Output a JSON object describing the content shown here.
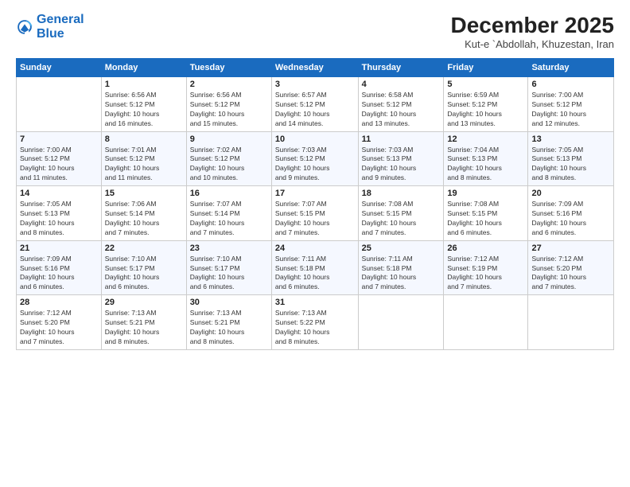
{
  "logo": {
    "line1": "General",
    "line2": "Blue"
  },
  "title": "December 2025",
  "subtitle": "Kut-e `Abdollah, Khuzestan, Iran",
  "days_header": [
    "Sunday",
    "Monday",
    "Tuesday",
    "Wednesday",
    "Thursday",
    "Friday",
    "Saturday"
  ],
  "weeks": [
    [
      {
        "day": "",
        "info": ""
      },
      {
        "day": "1",
        "info": "Sunrise: 6:56 AM\nSunset: 5:12 PM\nDaylight: 10 hours\nand 16 minutes."
      },
      {
        "day": "2",
        "info": "Sunrise: 6:56 AM\nSunset: 5:12 PM\nDaylight: 10 hours\nand 15 minutes."
      },
      {
        "day": "3",
        "info": "Sunrise: 6:57 AM\nSunset: 5:12 PM\nDaylight: 10 hours\nand 14 minutes."
      },
      {
        "day": "4",
        "info": "Sunrise: 6:58 AM\nSunset: 5:12 PM\nDaylight: 10 hours\nand 13 minutes."
      },
      {
        "day": "5",
        "info": "Sunrise: 6:59 AM\nSunset: 5:12 PM\nDaylight: 10 hours\nand 13 minutes."
      },
      {
        "day": "6",
        "info": "Sunrise: 7:00 AM\nSunset: 5:12 PM\nDaylight: 10 hours\nand 12 minutes."
      }
    ],
    [
      {
        "day": "7",
        "info": "Sunrise: 7:00 AM\nSunset: 5:12 PM\nDaylight: 10 hours\nand 11 minutes."
      },
      {
        "day": "8",
        "info": "Sunrise: 7:01 AM\nSunset: 5:12 PM\nDaylight: 10 hours\nand 11 minutes."
      },
      {
        "day": "9",
        "info": "Sunrise: 7:02 AM\nSunset: 5:12 PM\nDaylight: 10 hours\nand 10 minutes."
      },
      {
        "day": "10",
        "info": "Sunrise: 7:03 AM\nSunset: 5:12 PM\nDaylight: 10 hours\nand 9 minutes."
      },
      {
        "day": "11",
        "info": "Sunrise: 7:03 AM\nSunset: 5:13 PM\nDaylight: 10 hours\nand 9 minutes."
      },
      {
        "day": "12",
        "info": "Sunrise: 7:04 AM\nSunset: 5:13 PM\nDaylight: 10 hours\nand 8 minutes."
      },
      {
        "day": "13",
        "info": "Sunrise: 7:05 AM\nSunset: 5:13 PM\nDaylight: 10 hours\nand 8 minutes."
      }
    ],
    [
      {
        "day": "14",
        "info": "Sunrise: 7:05 AM\nSunset: 5:13 PM\nDaylight: 10 hours\nand 8 minutes."
      },
      {
        "day": "15",
        "info": "Sunrise: 7:06 AM\nSunset: 5:14 PM\nDaylight: 10 hours\nand 7 minutes."
      },
      {
        "day": "16",
        "info": "Sunrise: 7:07 AM\nSunset: 5:14 PM\nDaylight: 10 hours\nand 7 minutes."
      },
      {
        "day": "17",
        "info": "Sunrise: 7:07 AM\nSunset: 5:15 PM\nDaylight: 10 hours\nand 7 minutes."
      },
      {
        "day": "18",
        "info": "Sunrise: 7:08 AM\nSunset: 5:15 PM\nDaylight: 10 hours\nand 7 minutes."
      },
      {
        "day": "19",
        "info": "Sunrise: 7:08 AM\nSunset: 5:15 PM\nDaylight: 10 hours\nand 6 minutes."
      },
      {
        "day": "20",
        "info": "Sunrise: 7:09 AM\nSunset: 5:16 PM\nDaylight: 10 hours\nand 6 minutes."
      }
    ],
    [
      {
        "day": "21",
        "info": "Sunrise: 7:09 AM\nSunset: 5:16 PM\nDaylight: 10 hours\nand 6 minutes."
      },
      {
        "day": "22",
        "info": "Sunrise: 7:10 AM\nSunset: 5:17 PM\nDaylight: 10 hours\nand 6 minutes."
      },
      {
        "day": "23",
        "info": "Sunrise: 7:10 AM\nSunset: 5:17 PM\nDaylight: 10 hours\nand 6 minutes."
      },
      {
        "day": "24",
        "info": "Sunrise: 7:11 AM\nSunset: 5:18 PM\nDaylight: 10 hours\nand 6 minutes."
      },
      {
        "day": "25",
        "info": "Sunrise: 7:11 AM\nSunset: 5:18 PM\nDaylight: 10 hours\nand 7 minutes."
      },
      {
        "day": "26",
        "info": "Sunrise: 7:12 AM\nSunset: 5:19 PM\nDaylight: 10 hours\nand 7 minutes."
      },
      {
        "day": "27",
        "info": "Sunrise: 7:12 AM\nSunset: 5:20 PM\nDaylight: 10 hours\nand 7 minutes."
      }
    ],
    [
      {
        "day": "28",
        "info": "Sunrise: 7:12 AM\nSunset: 5:20 PM\nDaylight: 10 hours\nand 7 minutes."
      },
      {
        "day": "29",
        "info": "Sunrise: 7:13 AM\nSunset: 5:21 PM\nDaylight: 10 hours\nand 8 minutes."
      },
      {
        "day": "30",
        "info": "Sunrise: 7:13 AM\nSunset: 5:21 PM\nDaylight: 10 hours\nand 8 minutes."
      },
      {
        "day": "31",
        "info": "Sunrise: 7:13 AM\nSunset: 5:22 PM\nDaylight: 10 hours\nand 8 minutes."
      },
      {
        "day": "",
        "info": ""
      },
      {
        "day": "",
        "info": ""
      },
      {
        "day": "",
        "info": ""
      }
    ]
  ]
}
